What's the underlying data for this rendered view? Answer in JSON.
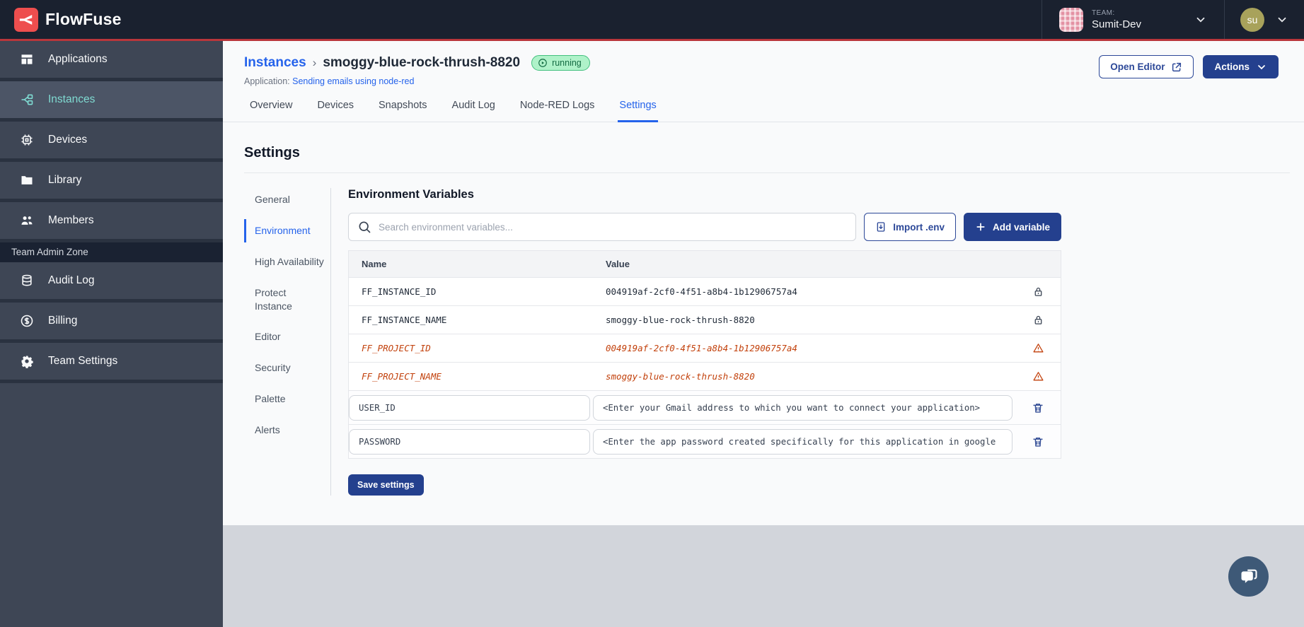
{
  "brand": {
    "name": "FlowFuse"
  },
  "topbar": {
    "team_label": "TEAM:",
    "team_name": "Sumit-Dev",
    "user_initials": "su"
  },
  "sidebar": {
    "items": [
      {
        "label": "Applications",
        "icon": "applications-icon",
        "active": false
      },
      {
        "label": "Instances",
        "icon": "instances-icon",
        "active": true
      },
      {
        "label": "Devices",
        "icon": "devices-icon",
        "active": false
      },
      {
        "label": "Library",
        "icon": "library-icon",
        "active": false
      },
      {
        "label": "Members",
        "icon": "members-icon",
        "active": false
      }
    ],
    "admin_zone_label": "Team Admin Zone",
    "admin_items": [
      {
        "label": "Audit Log",
        "icon": "audit-log-icon",
        "active": false
      },
      {
        "label": "Billing",
        "icon": "billing-icon",
        "active": false
      },
      {
        "label": "Team Settings",
        "icon": "team-settings-icon",
        "active": false
      }
    ]
  },
  "header": {
    "breadcrumb_root": "Instances",
    "breadcrumb_separator": "›",
    "instance_name": "smoggy-blue-rock-thrush-8820",
    "status": "running",
    "application_label": "Application:",
    "application_name": "Sending emails using node-red",
    "open_editor_label": "Open Editor",
    "actions_label": "Actions"
  },
  "tabs": [
    {
      "label": "Overview",
      "active": false
    },
    {
      "label": "Devices",
      "active": false
    },
    {
      "label": "Snapshots",
      "active": false
    },
    {
      "label": "Audit Log",
      "active": false
    },
    {
      "label": "Node-RED Logs",
      "active": false
    },
    {
      "label": "Settings",
      "active": true
    }
  ],
  "settings": {
    "title": "Settings",
    "nav": [
      {
        "label": "General",
        "active": false
      },
      {
        "label": "Environment",
        "active": true
      },
      {
        "label": "High Availability",
        "active": false
      },
      {
        "label": "Protect Instance",
        "active": false
      },
      {
        "label": "Editor",
        "active": false
      },
      {
        "label": "Security",
        "active": false
      },
      {
        "label": "Palette",
        "active": false
      },
      {
        "label": "Alerts",
        "active": false
      }
    ],
    "section_title": "Environment Variables",
    "search_placeholder": "Search environment variables...",
    "import_button": "Import .env",
    "add_button": "Add variable",
    "save_button": "Save settings",
    "table": {
      "columns": [
        "Name",
        "Value"
      ],
      "rows": [
        {
          "name": "FF_INSTANCE_ID",
          "value": "004919af-2cf0-4f51-a8b4-1b12906757a4",
          "state": "locked"
        },
        {
          "name": "FF_INSTANCE_NAME",
          "value": "smoggy-blue-rock-thrush-8820",
          "state": "locked"
        },
        {
          "name": "FF_PROJECT_ID",
          "value": "004919af-2cf0-4f51-a8b4-1b12906757a4",
          "state": "deprecated"
        },
        {
          "name": "FF_PROJECT_NAME",
          "value": "smoggy-blue-rock-thrush-8820",
          "state": "deprecated"
        },
        {
          "name": "USER_ID",
          "value": "<Enter your Gmail address to which you want to connect your application>",
          "state": "editable"
        },
        {
          "name": "PASSWORD",
          "value": "<Enter the app password created specifically for this application in google",
          "state": "editable"
        }
      ]
    }
  },
  "colors": {
    "brand_red": "#EE4E4E",
    "accent_line_red": "#B9363B",
    "primary_navy": "#24408E",
    "link_blue": "#2563EB",
    "sidebar_active_teal": "#7FDBD2",
    "running_badge_bg": "#AFF2C9",
    "running_badge_text": "#136B42",
    "warning_orange": "#C2410C"
  }
}
